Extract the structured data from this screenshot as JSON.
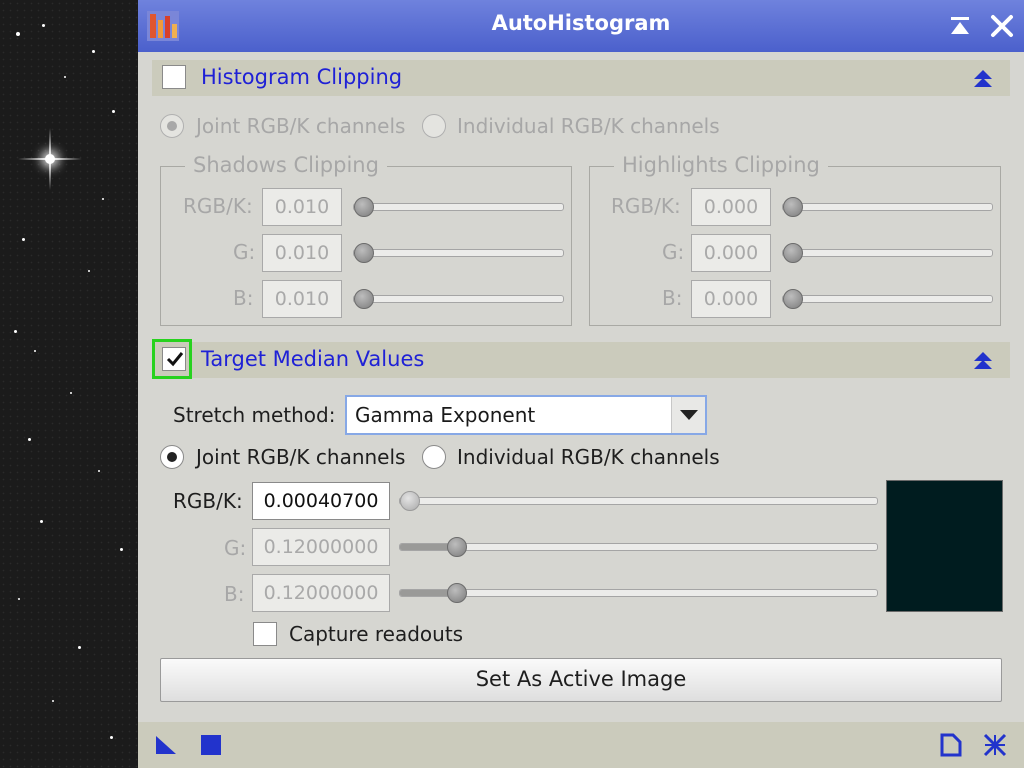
{
  "window": {
    "title": "AutoHistogram"
  },
  "histogram_clipping": {
    "header": "Histogram Clipping",
    "checked": false,
    "mode_joint": "Joint RGB/K channels",
    "mode_individual": "Individual RGB/K channels",
    "shadows": {
      "title": "Shadows Clipping",
      "rows": [
        {
          "label": "RGB/K:",
          "value": "0.010"
        },
        {
          "label": "G:",
          "value": "0.010"
        },
        {
          "label": "B:",
          "value": "0.010"
        }
      ]
    },
    "highlights": {
      "title": "Highlights Clipping",
      "rows": [
        {
          "label": "RGB/K:",
          "value": "0.000"
        },
        {
          "label": "G:",
          "value": "0.000"
        },
        {
          "label": "B:",
          "value": "0.000"
        }
      ]
    }
  },
  "target_median": {
    "header": "Target Median Values",
    "checked": true,
    "stretch_label": "Stretch method:",
    "stretch_value": "Gamma Exponent",
    "mode_joint": "Joint RGB/K channels",
    "mode_individual": "Individual RGB/K channels",
    "rows": [
      {
        "label": "RGB/K:",
        "value": "0.00040700",
        "level": 0.000407,
        "enabled": true
      },
      {
        "label": "G:",
        "value": "0.12000000",
        "level": 0.12,
        "enabled": false
      },
      {
        "label": "B:",
        "value": "0.12000000",
        "level": 0.12,
        "enabled": false
      }
    ],
    "swatch_color": "#001c1f",
    "capture_label": "Capture readouts",
    "set_active_label": "Set As Active Image"
  },
  "colors": {
    "title_bar": "#5a6fd6",
    "section_title": "#1f21d6",
    "focus_ring": "#27d21e"
  },
  "icons": {
    "app": "autohistogram-app-icon",
    "shade": "shade-icon",
    "close": "close-icon",
    "collapse": "collapse-icon",
    "new_instance": "new-instance-icon",
    "apply_global": "apply-global-icon",
    "preview": "document-icon",
    "reset": "reset-icon"
  }
}
